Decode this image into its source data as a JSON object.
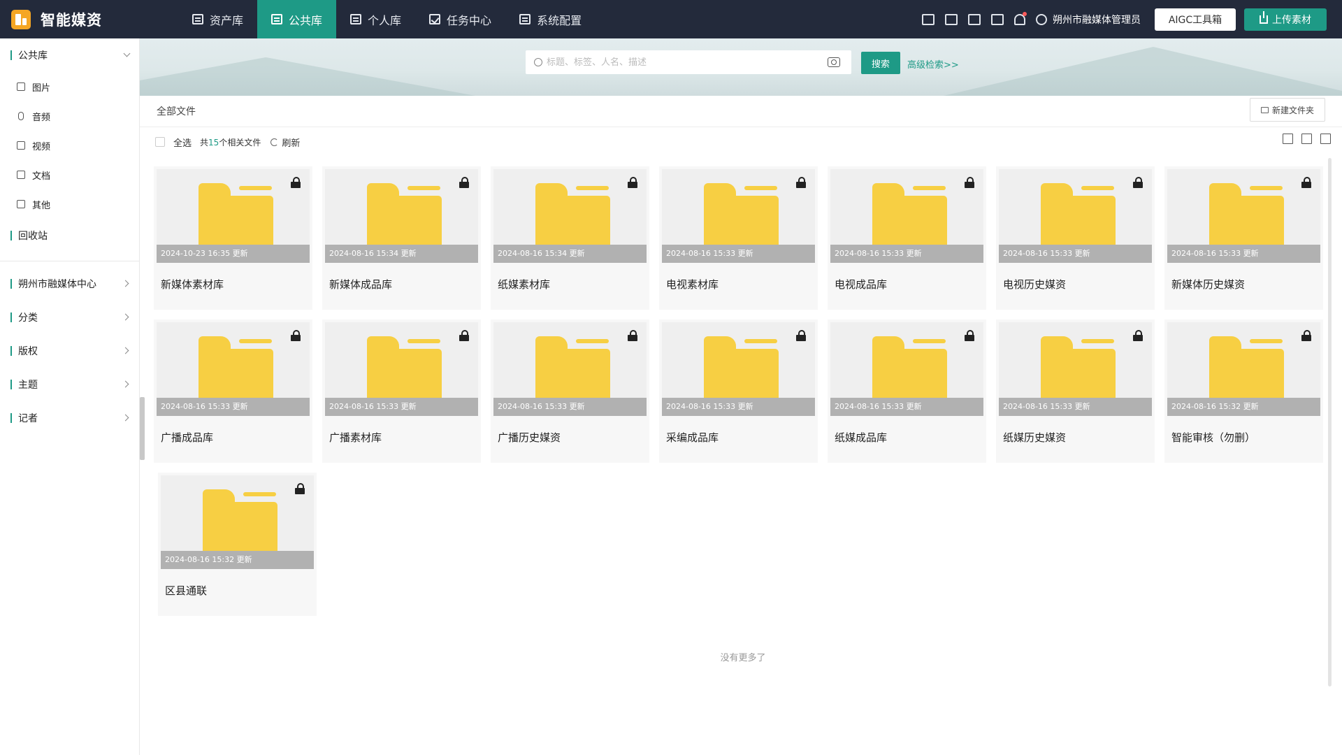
{
  "app": {
    "title": "智能媒资",
    "brand_color": "#f5a623",
    "accent_color": "#1e9a86",
    "topbar_color": "#232a3b"
  },
  "nav": {
    "tabs": [
      {
        "label": "资产库",
        "icon": "database-icon",
        "active": false
      },
      {
        "label": "公共库",
        "icon": "folder-image-icon",
        "active": true
      },
      {
        "label": "个人库",
        "icon": "person-doc-icon",
        "active": false
      },
      {
        "label": "任务中心",
        "icon": "task-check-icon",
        "active": false
      },
      {
        "label": "系统配置",
        "icon": "settings-monitor-icon",
        "active": false
      }
    ]
  },
  "header": {
    "icons": [
      "calendar-check-icon",
      "chart-icon",
      "grid-icon",
      "shirt-icon",
      "bell-icon"
    ],
    "user_name": "朔州市融媒体管理员",
    "aigc_label": "AIGC工具箱",
    "upload_label": "上传素材"
  },
  "sidebar": {
    "library_title": "公共库",
    "library_items": [
      {
        "label": "图片",
        "icon": "image-icon"
      },
      {
        "label": "音频",
        "icon": "microphone-icon"
      },
      {
        "label": "视频",
        "icon": "video-icon"
      },
      {
        "label": "文档",
        "icon": "document-icon"
      },
      {
        "label": "其他",
        "icon": "layers-icon"
      }
    ],
    "recycle": "回收站",
    "groups": [
      "朔州市融媒体中心",
      "分类",
      "版权",
      "主题",
      "记者"
    ]
  },
  "search": {
    "placeholder": "标题、标签、人名、描述",
    "button": "搜索",
    "advanced": "高级检索>>"
  },
  "content": {
    "breadcrumb": "全部文件",
    "new_folder": "新建文件夹",
    "select_all": "全选",
    "count_prefix": "共",
    "count": "15",
    "count_suffix": "个相关文件",
    "refresh": "刷新",
    "view_icons": [
      "sort-icon",
      "list-view-icon",
      "grid-view-icon"
    ],
    "no_more": "没有更多了"
  },
  "folders": [
    {
      "name": "新媒体素材库",
      "updated": "2024-10-23 16:35 更新",
      "locked": true
    },
    {
      "name": "新媒体成品库",
      "updated": "2024-08-16 15:34 更新",
      "locked": true
    },
    {
      "name": "纸媒素材库",
      "updated": "2024-08-16 15:34 更新",
      "locked": true
    },
    {
      "name": "电视素材库",
      "updated": "2024-08-16 15:33 更新",
      "locked": true
    },
    {
      "name": "电视成品库",
      "updated": "2024-08-16 15:33 更新",
      "locked": true
    },
    {
      "name": "电视历史媒资",
      "updated": "2024-08-16 15:33 更新",
      "locked": true
    },
    {
      "name": "新媒体历史媒资",
      "updated": "2024-08-16 15:33 更新",
      "locked": true
    },
    {
      "name": "广播成品库",
      "updated": "2024-08-16 15:33 更新",
      "locked": true
    },
    {
      "name": "广播素材库",
      "updated": "2024-08-16 15:33 更新",
      "locked": true
    },
    {
      "name": "广播历史媒资",
      "updated": "2024-08-16 15:33 更新",
      "locked": true
    },
    {
      "name": "采编成品库",
      "updated": "2024-08-16 15:33 更新",
      "locked": true
    },
    {
      "name": "纸媒成品库",
      "updated": "2024-08-16 15:33 更新",
      "locked": true
    },
    {
      "name": "纸媒历史媒资",
      "updated": "2024-08-16 15:33 更新",
      "locked": true
    },
    {
      "name": "智能审核（勿删）",
      "updated": "2024-08-16 15:32 更新",
      "locked": true
    },
    {
      "name": "区县通联",
      "updated": "2024-08-16 15:32 更新",
      "locked": true
    }
  ]
}
